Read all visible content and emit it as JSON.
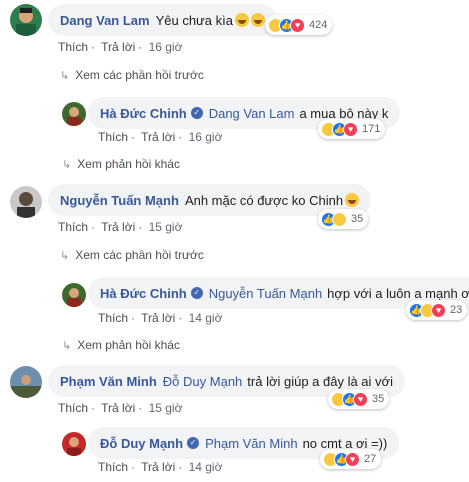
{
  "actions": {
    "like": "Thích",
    "reply": "Trả lời"
  },
  "colors": {
    "name": "#385898",
    "bubble": "#f2f3f5",
    "like": "#1877f2",
    "love": "#f33e58",
    "haha": "#f7c940"
  },
  "comments": [
    {
      "author": "Dang Van Lam",
      "text": "Yêu chưa kìa",
      "time": "16 giờ",
      "reactions": "424",
      "replies_link": "Xem các phần hồi trước",
      "reply": {
        "author": "Hà Đức Chinh",
        "mention": "Dang Van Lam",
        "text": "a mua bộ này k",
        "time": "16 giờ",
        "reactions": "171"
      },
      "more_link": "Xem phản hồi khác"
    },
    {
      "author": "Nguyễn Tuấn Mạnh",
      "text": "Anh mặc có được ko Chinh",
      "time": "15 giờ",
      "reactions": "35",
      "replies_link": "Xem các phần hồi trước",
      "reply": {
        "author": "Hà Đức Chinh",
        "mention": "Nguyễn Tuấn Mạnh",
        "text": "hợp với a luôn a mạnh ơi",
        "time": "14 giờ",
        "reactions": "23"
      },
      "more_link": "Xem phản hồi khác"
    },
    {
      "author": "Phạm Văn Minh",
      "mention": "Đỗ Duy Mạnh",
      "text": "trả lời giúp a đây là ai với",
      "time": "15 giờ",
      "reactions": "35",
      "reply": {
        "author": "Đỗ Duy Mạnh",
        "mention": "Phạm Văn Minh",
        "text": "no cmt a ơi =))",
        "time": "14 giờ",
        "reactions": "27"
      }
    }
  ]
}
